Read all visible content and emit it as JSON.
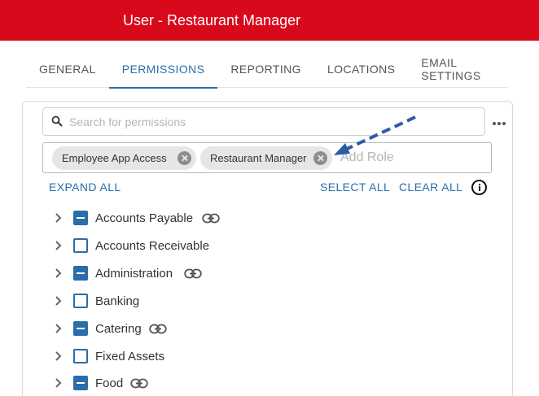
{
  "header": {
    "title": "User - Restaurant Manager"
  },
  "tabs": [
    {
      "label": "GENERAL",
      "active": false
    },
    {
      "label": "PERMISSIONS",
      "active": true
    },
    {
      "label": "REPORTING",
      "active": false
    },
    {
      "label": "LOCATIONS",
      "active": false
    },
    {
      "label": "EMAIL SETTINGS",
      "active": false
    }
  ],
  "search": {
    "placeholder": "Search for permissions",
    "value": ""
  },
  "roles": {
    "chips": [
      "Employee App Access",
      "Restaurant Manager"
    ],
    "add_placeholder": "Add Role"
  },
  "actions": {
    "expand_all": "EXPAND ALL",
    "select_all": "SELECT ALL",
    "clear_all": "CLEAR ALL"
  },
  "permissions": [
    {
      "label": "Accounts Payable",
      "state": "partial",
      "linked": true
    },
    {
      "label": "Accounts Receivable",
      "state": "empty",
      "linked": false
    },
    {
      "label": "Administration",
      "state": "partial",
      "linked": true
    },
    {
      "label": "Banking",
      "state": "empty",
      "linked": false
    },
    {
      "label": "Catering",
      "state": "partial",
      "linked": true
    },
    {
      "label": "Fixed Assets",
      "state": "empty",
      "linked": false
    },
    {
      "label": "Food",
      "state": "partial",
      "linked": true
    }
  ],
  "colors": {
    "header": "#d9091c",
    "accent": "#2b6da9",
    "arrow": "#2b5ea8"
  },
  "icons": {
    "search": "search-icon",
    "more": "more-vert-icon",
    "remove": "close-circle-icon",
    "info": "info-icon",
    "expand": "chevron-right-icon",
    "link": "link-icon"
  }
}
